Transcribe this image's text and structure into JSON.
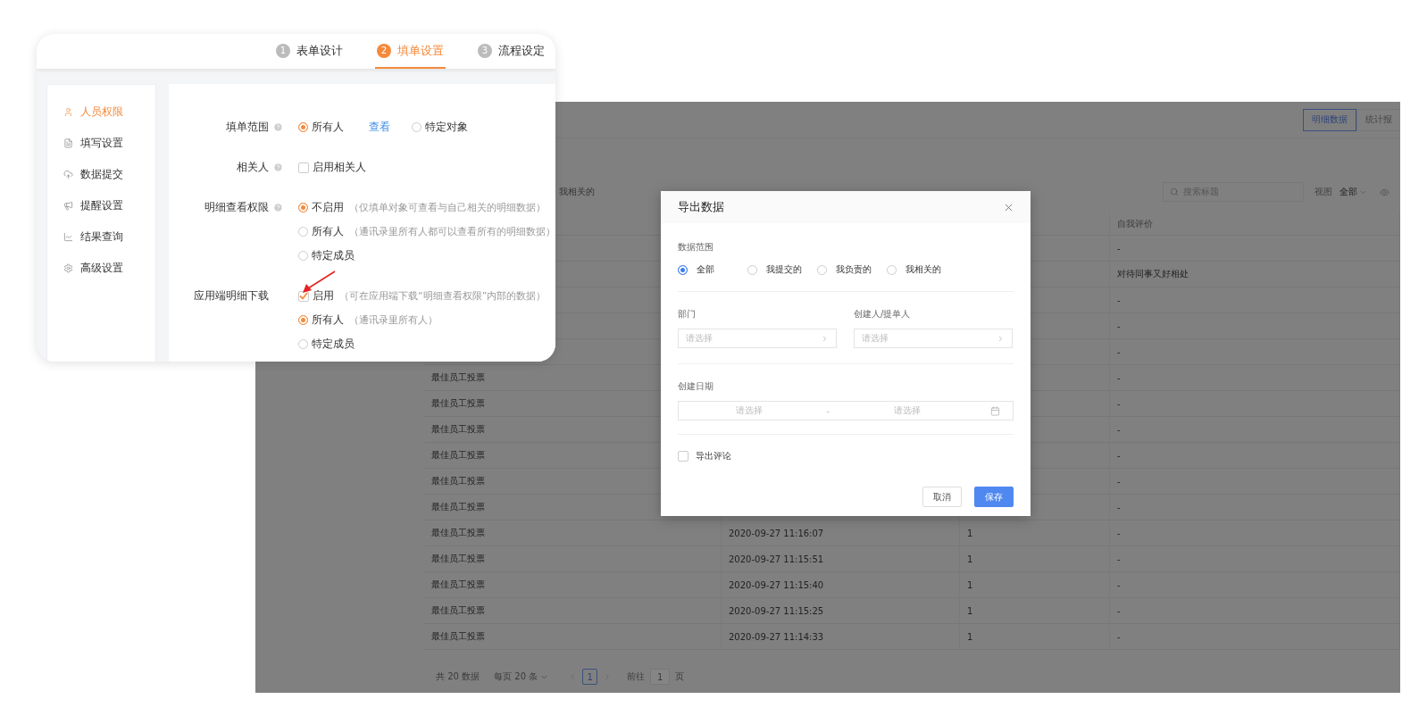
{
  "settings_card": {
    "steps": [
      {
        "number": "1",
        "label": "表单设计",
        "selected": false
      },
      {
        "number": "2",
        "label": "填单设置",
        "selected": true
      },
      {
        "number": "3",
        "label": "流程设定",
        "selected": false
      }
    ],
    "sidebar": {
      "items": [
        {
          "label": "人员权限",
          "selected": true
        },
        {
          "label": "填写设置",
          "selected": false
        },
        {
          "label": "数据提交",
          "selected": false
        },
        {
          "label": "提醒设置",
          "selected": false
        },
        {
          "label": "结果查询",
          "selected": false
        },
        {
          "label": "高级设置",
          "selected": false
        }
      ]
    },
    "fields": [
      {
        "label": "填单范围",
        "help": true,
        "lines": [
          [
            {
              "kind": "radio",
              "label": "所有人",
              "selected": true
            },
            {
              "kind": "link",
              "label": "查看"
            },
            {
              "kind": "radio",
              "label": "特定对象",
              "selected": false
            }
          ]
        ]
      },
      {
        "label": "相关人",
        "help": true,
        "lines": [
          [
            {
              "kind": "checkbox",
              "label": "启用相关人",
              "checked": false
            }
          ]
        ]
      },
      {
        "label": "明细查看权限",
        "help": true,
        "lines": [
          [
            {
              "kind": "radio",
              "label": "不启用",
              "hint": "（仅填单对象可查看与自己相关的明细数据）",
              "selected": true
            }
          ],
          [
            {
              "kind": "radio",
              "label": "所有人",
              "hint": "（通讯录里所有人都可以查看所有的明细数据）",
              "selected": false
            }
          ],
          [
            {
              "kind": "radio",
              "label": "特定成员",
              "selected": false
            }
          ]
        ]
      },
      {
        "label": "应用端明细下载",
        "help": false,
        "lines": [
          [
            {
              "kind": "checkbox",
              "label": "启用",
              "hint": "（可在应用端下载“明细查看权限”内部的数据）",
              "checked": true
            }
          ],
          [
            {
              "kind": "radio",
              "label": "所有人",
              "hint": "（通讯录里所有人）",
              "selected": true
            }
          ],
          [
            {
              "kind": "radio",
              "label": "特定成员",
              "selected": false
            }
          ]
        ]
      }
    ]
  },
  "data_page": {
    "view_tabs": [
      {
        "label": "明细数据",
        "selected": true
      },
      {
        "label": "统计报",
        "selected": false
      }
    ],
    "filter_fragment": "我相关的",
    "search": {
      "placeholder": "搜索标题"
    },
    "view_label": "视图",
    "view_value": "全部",
    "table": {
      "header": {
        "self_evaluation": "自我评价"
      },
      "rows": [
        {
          "self_evaluation": "-"
        },
        {
          "self_evaluation": "对待同事又好相处"
        },
        {
          "self_evaluation": "-"
        },
        {
          "self_evaluation": "-"
        },
        {
          "self_evaluation": "-"
        },
        {
          "column_1": "最佳员工投票",
          "self_evaluation": "-"
        },
        {
          "column_1": "最佳员工投票",
          "self_evaluation": "-"
        },
        {
          "column_1": "最佳员工投票",
          "self_evaluation": "-"
        },
        {
          "column_1": "最佳员工投票",
          "self_evaluation": "-"
        },
        {
          "column_1": "最佳员工投票",
          "self_evaluation": "-"
        },
        {
          "column_1": "最佳员工投票",
          "self_evaluation": "-"
        },
        {
          "column_1": "最佳员工投票",
          "column_2": "2020-09-27 11:16:07",
          "column_3": "1",
          "self_evaluation": "-"
        },
        {
          "column_1": "最佳员工投票",
          "column_2": "2020-09-27 11:15:51",
          "column_3": "1",
          "self_evaluation": "-"
        },
        {
          "column_1": "最佳员工投票",
          "column_2": "2020-09-27 11:15:40",
          "column_3": "1",
          "self_evaluation": "-"
        },
        {
          "column_1": "最佳员工投票",
          "column_2": "2020-09-27 11:15:25",
          "column_3": "1",
          "self_evaluation": "-"
        },
        {
          "column_1": "最佳员工投票",
          "column_2": "2020-09-27 11:14:33",
          "column_3": "1",
          "self_evaluation": "-"
        }
      ]
    },
    "pagination": {
      "total": "共 20 数据",
      "page_size": "每页 20 条",
      "pages": [
        {
          "label": "1",
          "selected": true
        }
      ],
      "goto_label": "前往",
      "goto_value": "1",
      "goto_unit": "页"
    }
  },
  "export_dialog": {
    "title": "导出数据",
    "scope_label": "数据范围",
    "scope_options": [
      {
        "label": "全部",
        "selected": true
      },
      {
        "label": "我提交的",
        "selected": false
      },
      {
        "label": "我负责的",
        "selected": false
      },
      {
        "label": "我相关的",
        "selected": false
      }
    ],
    "department": {
      "label": "部门",
      "placeholder": "请选择"
    },
    "creator": {
      "label": "创建人/提单人",
      "placeholder": "请选择"
    },
    "created_date": {
      "label": "创建日期",
      "start_placeholder": "请选择",
      "separator": "-",
      "end_placeholder": "请选择"
    },
    "export_comments": {
      "label": "导出评论",
      "checked": false
    },
    "buttons": [
      {
        "kind": "secondary",
        "label": "取消"
      },
      {
        "kind": "primary",
        "label": "保存"
      }
    ]
  }
}
